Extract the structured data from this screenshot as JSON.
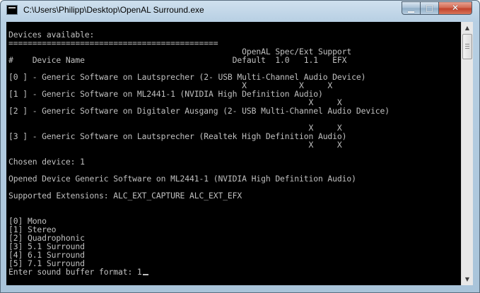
{
  "window": {
    "title": "C:\\Users\\Philipp\\Desktop\\OpenAL Surround.exe",
    "icon": "console-app-icon",
    "buttons": {
      "minimize_glyph": "▁",
      "maximize_glyph": "□",
      "close_glyph": "✕"
    }
  },
  "console": {
    "foreground": "#c0c0c0",
    "background": "#000000",
    "lines": [
      "",
      "Devices available:",
      "============================================",
      "                                                 OpenAL Spec/Ext Support",
      "#    Device Name                               Default  1.0   1.1   EFX",
      "",
      "[0 ] - Generic Software on Lautsprecher (2- USB Multi-Channel Audio Device)",
      "                                                 X           X     X",
      "[1 ] - Generic Software on ML2441-1 (NVIDIA High Definition Audio)",
      "                                                               X     X",
      "[2 ] - Generic Software on Digitaler Ausgang (2- USB Multi-Channel Audio Device)",
      "",
      "                                                               X     X",
      "[3 ] - Generic Software on Lautsprecher (Realtek High Definition Audio)",
      "                                                               X     X",
      "",
      "Chosen device: 1",
      "",
      "Opened Device Generic Software on ML2441-1 (NVIDIA High Definition Audio)",
      "",
      "Supported Extensions: ALC_EXT_CAPTURE ALC_EXT_EFX",
      "",
      "",
      "[0] Mono",
      "[1] Stereo",
      "[2] Quadrophonic",
      "[3] 5.1 Surround",
      "[4] 6.1 Surround",
      "[5] 7.1 Surround",
      "Enter sound buffer format: 1"
    ]
  },
  "scrollbar": {
    "up_glyph": "▲",
    "down_glyph": "▼"
  }
}
